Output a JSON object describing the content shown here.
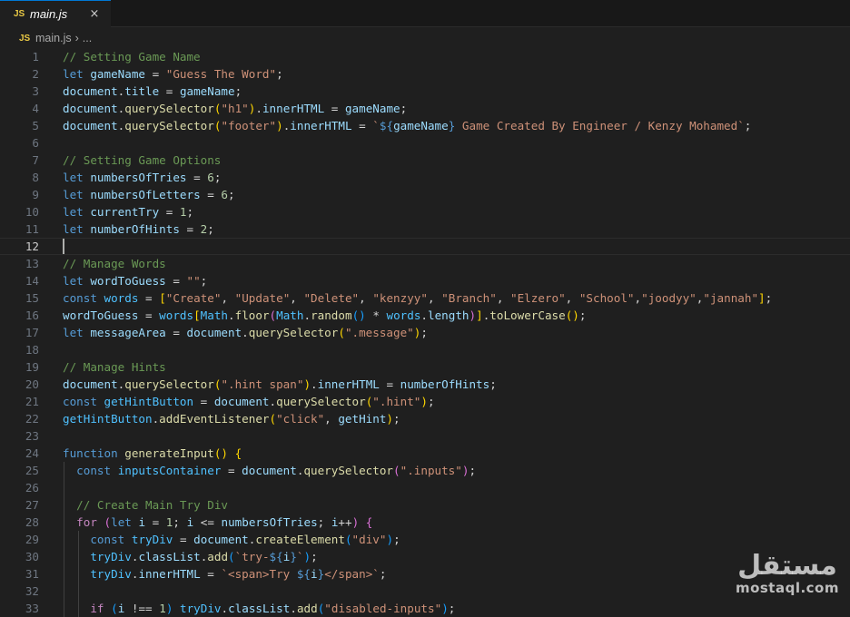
{
  "tab": {
    "icon_text": "JS",
    "file_name": "main.js",
    "close_glyph": "×"
  },
  "breadcrumb": {
    "icon_text": "JS",
    "file": "main.js",
    "separator": "›",
    "more": "..."
  },
  "editor": {
    "current_line": 12,
    "lines": [
      {
        "n": "1",
        "tokens": [
          [
            "cm",
            "// Setting Game Name"
          ]
        ]
      },
      {
        "n": "2",
        "tokens": [
          [
            "kw",
            "let"
          ],
          [
            "op",
            " "
          ],
          [
            "var",
            "gameName"
          ],
          [
            "op",
            " = "
          ],
          [
            "str",
            "\"Guess The Word\""
          ],
          [
            "op",
            ";"
          ]
        ]
      },
      {
        "n": "3",
        "tokens": [
          [
            "var",
            "document"
          ],
          [
            "op",
            "."
          ],
          [
            "var",
            "title"
          ],
          [
            "op",
            " = "
          ],
          [
            "var",
            "gameName"
          ],
          [
            "op",
            ";"
          ]
        ]
      },
      {
        "n": "4",
        "tokens": [
          [
            "var",
            "document"
          ],
          [
            "op",
            "."
          ],
          [
            "fn",
            "querySelector"
          ],
          [
            "b1",
            "("
          ],
          [
            "str",
            "\"h1\""
          ],
          [
            "b1",
            ")"
          ],
          [
            "op",
            "."
          ],
          [
            "var",
            "innerHTML"
          ],
          [
            "op",
            " = "
          ],
          [
            "var",
            "gameName"
          ],
          [
            "op",
            ";"
          ]
        ]
      },
      {
        "n": "5",
        "tokens": [
          [
            "var",
            "document"
          ],
          [
            "op",
            "."
          ],
          [
            "fn",
            "querySelector"
          ],
          [
            "b1",
            "("
          ],
          [
            "str",
            "\"footer\""
          ],
          [
            "b1",
            ")"
          ],
          [
            "op",
            "."
          ],
          [
            "var",
            "innerHTML"
          ],
          [
            "op",
            " = "
          ],
          [
            "str",
            "`"
          ],
          [
            "kw",
            "${"
          ],
          [
            "var",
            "gameName"
          ],
          [
            "kw",
            "}"
          ],
          [
            "str",
            " Game Created By Engineer / Kenzy Mohamed`"
          ],
          [
            "op",
            ";"
          ]
        ]
      },
      {
        "n": "6",
        "tokens": []
      },
      {
        "n": "7",
        "tokens": [
          [
            "cm",
            "// Setting Game Options"
          ]
        ]
      },
      {
        "n": "8",
        "tokens": [
          [
            "kw",
            "let"
          ],
          [
            "op",
            " "
          ],
          [
            "var",
            "numbersOfTries"
          ],
          [
            "op",
            " = "
          ],
          [
            "num",
            "6"
          ],
          [
            "op",
            ";"
          ]
        ]
      },
      {
        "n": "9",
        "tokens": [
          [
            "kw",
            "let"
          ],
          [
            "op",
            " "
          ],
          [
            "var",
            "numbersOfLetters"
          ],
          [
            "op",
            " = "
          ],
          [
            "num",
            "6"
          ],
          [
            "op",
            ";"
          ]
        ]
      },
      {
        "n": "10",
        "tokens": [
          [
            "kw",
            "let"
          ],
          [
            "op",
            " "
          ],
          [
            "var",
            "currentTry"
          ],
          [
            "op",
            " = "
          ],
          [
            "num",
            "1"
          ],
          [
            "op",
            ";"
          ]
        ]
      },
      {
        "n": "11",
        "tokens": [
          [
            "kw",
            "let"
          ],
          [
            "op",
            " "
          ],
          [
            "var",
            "numberOfHints"
          ],
          [
            "op",
            " = "
          ],
          [
            "num",
            "2"
          ],
          [
            "op",
            ";"
          ]
        ]
      },
      {
        "n": "12",
        "tokens": []
      },
      {
        "n": "13",
        "tokens": [
          [
            "cm",
            "// Manage Words"
          ]
        ]
      },
      {
        "n": "14",
        "tokens": [
          [
            "kw",
            "let"
          ],
          [
            "op",
            " "
          ],
          [
            "var",
            "wordToGuess"
          ],
          [
            "op",
            " = "
          ],
          [
            "str",
            "\"\""
          ],
          [
            "op",
            ";"
          ]
        ]
      },
      {
        "n": "15",
        "tokens": [
          [
            "kw",
            "const"
          ],
          [
            "op",
            " "
          ],
          [
            "cvar",
            "words"
          ],
          [
            "op",
            " = "
          ],
          [
            "b1",
            "["
          ],
          [
            "str",
            "\"Create\""
          ],
          [
            "op",
            ", "
          ],
          [
            "str",
            "\"Update\""
          ],
          [
            "op",
            ", "
          ],
          [
            "str",
            "\"Delete\""
          ],
          [
            "op",
            ", "
          ],
          [
            "str",
            "\"kenzyy\""
          ],
          [
            "op",
            ", "
          ],
          [
            "str",
            "\"Branch\""
          ],
          [
            "op",
            ", "
          ],
          [
            "str",
            "\"Elzero\""
          ],
          [
            "op",
            ", "
          ],
          [
            "str",
            "\"School\""
          ],
          [
            "op",
            ","
          ],
          [
            "str",
            "\"joodyy\""
          ],
          [
            "op",
            ","
          ],
          [
            "str",
            "\"jannah\""
          ],
          [
            "b1",
            "]"
          ],
          [
            "op",
            ";"
          ]
        ]
      },
      {
        "n": "16",
        "tokens": [
          [
            "var",
            "wordToGuess"
          ],
          [
            "op",
            " = "
          ],
          [
            "cvar",
            "words"
          ],
          [
            "b1",
            "["
          ],
          [
            "cvar",
            "Math"
          ],
          [
            "op",
            "."
          ],
          [
            "fn",
            "floor"
          ],
          [
            "b2",
            "("
          ],
          [
            "cvar",
            "Math"
          ],
          [
            "op",
            "."
          ],
          [
            "fn",
            "random"
          ],
          [
            "b3",
            "()"
          ],
          [
            "op",
            " * "
          ],
          [
            "cvar",
            "words"
          ],
          [
            "op",
            "."
          ],
          [
            "var",
            "length"
          ],
          [
            "b2",
            ")"
          ],
          [
            "b1",
            "]"
          ],
          [
            "op",
            "."
          ],
          [
            "fn",
            "toLowerCase"
          ],
          [
            "b1",
            "()"
          ],
          [
            "op",
            ";"
          ]
        ]
      },
      {
        "n": "17",
        "tokens": [
          [
            "kw",
            "let"
          ],
          [
            "op",
            " "
          ],
          [
            "var",
            "messageArea"
          ],
          [
            "op",
            " = "
          ],
          [
            "var",
            "document"
          ],
          [
            "op",
            "."
          ],
          [
            "fn",
            "querySelector"
          ],
          [
            "b1",
            "("
          ],
          [
            "str",
            "\".message\""
          ],
          [
            "b1",
            ")"
          ],
          [
            "op",
            ";"
          ]
        ]
      },
      {
        "n": "18",
        "tokens": []
      },
      {
        "n": "19",
        "tokens": [
          [
            "cm",
            "// Manage Hints"
          ]
        ]
      },
      {
        "n": "20",
        "tokens": [
          [
            "var",
            "document"
          ],
          [
            "op",
            "."
          ],
          [
            "fn",
            "querySelector"
          ],
          [
            "b1",
            "("
          ],
          [
            "str",
            "\".hint span\""
          ],
          [
            "b1",
            ")"
          ],
          [
            "op",
            "."
          ],
          [
            "var",
            "innerHTML"
          ],
          [
            "op",
            " = "
          ],
          [
            "var",
            "numberOfHints"
          ],
          [
            "op",
            ";"
          ]
        ]
      },
      {
        "n": "21",
        "tokens": [
          [
            "kw",
            "const"
          ],
          [
            "op",
            " "
          ],
          [
            "cvar",
            "getHintButton"
          ],
          [
            "op",
            " = "
          ],
          [
            "var",
            "document"
          ],
          [
            "op",
            "."
          ],
          [
            "fn",
            "querySelector"
          ],
          [
            "b1",
            "("
          ],
          [
            "str",
            "\".hint\""
          ],
          [
            "b1",
            ")"
          ],
          [
            "op",
            ";"
          ]
        ]
      },
      {
        "n": "22",
        "tokens": [
          [
            "cvar",
            "getHintButton"
          ],
          [
            "op",
            "."
          ],
          [
            "fn",
            "addEventListener"
          ],
          [
            "b1",
            "("
          ],
          [
            "str",
            "\"click\""
          ],
          [
            "op",
            ", "
          ],
          [
            "var",
            "getHint"
          ],
          [
            "b1",
            ")"
          ],
          [
            "op",
            ";"
          ]
        ]
      },
      {
        "n": "23",
        "tokens": []
      },
      {
        "n": "24",
        "tokens": [
          [
            "kw",
            "function"
          ],
          [
            "op",
            " "
          ],
          [
            "fn",
            "generateInput"
          ],
          [
            "b1",
            "()"
          ],
          [
            "op",
            " "
          ],
          [
            "b1",
            "{"
          ]
        ]
      },
      {
        "n": "25",
        "tokens": [
          [
            "op",
            "  "
          ],
          [
            "kw",
            "const"
          ],
          [
            "op",
            " "
          ],
          [
            "cvar",
            "inputsContainer"
          ],
          [
            "op",
            " = "
          ],
          [
            "var",
            "document"
          ],
          [
            "op",
            "."
          ],
          [
            "fn",
            "querySelector"
          ],
          [
            "b2",
            "("
          ],
          [
            "str",
            "\".inputs\""
          ],
          [
            "b2",
            ")"
          ],
          [
            "op",
            ";"
          ]
        ]
      },
      {
        "n": "26",
        "tokens": []
      },
      {
        "n": "27",
        "tokens": [
          [
            "op",
            "  "
          ],
          [
            "cm",
            "// Create Main Try Div"
          ]
        ]
      },
      {
        "n": "28",
        "tokens": [
          [
            "op",
            "  "
          ],
          [
            "cf",
            "for"
          ],
          [
            "op",
            " "
          ],
          [
            "b2",
            "("
          ],
          [
            "kw",
            "let"
          ],
          [
            "op",
            " "
          ],
          [
            "var",
            "i"
          ],
          [
            "op",
            " = "
          ],
          [
            "num",
            "1"
          ],
          [
            "op",
            "; "
          ],
          [
            "var",
            "i"
          ],
          [
            "op",
            " <= "
          ],
          [
            "var",
            "numbersOfTries"
          ],
          [
            "op",
            "; "
          ],
          [
            "var",
            "i"
          ],
          [
            "op",
            "++"
          ],
          [
            "b2",
            ")"
          ],
          [
            "op",
            " "
          ],
          [
            "b2",
            "{"
          ]
        ]
      },
      {
        "n": "29",
        "tokens": [
          [
            "op",
            "    "
          ],
          [
            "kw",
            "const"
          ],
          [
            "op",
            " "
          ],
          [
            "cvar",
            "tryDiv"
          ],
          [
            "op",
            " = "
          ],
          [
            "var",
            "document"
          ],
          [
            "op",
            "."
          ],
          [
            "fn",
            "createElement"
          ],
          [
            "b3",
            "("
          ],
          [
            "str",
            "\"div\""
          ],
          [
            "b3",
            ")"
          ],
          [
            "op",
            ";"
          ]
        ]
      },
      {
        "n": "30",
        "tokens": [
          [
            "op",
            "    "
          ],
          [
            "cvar",
            "tryDiv"
          ],
          [
            "op",
            "."
          ],
          [
            "var",
            "classList"
          ],
          [
            "op",
            "."
          ],
          [
            "fn",
            "add"
          ],
          [
            "b3",
            "("
          ],
          [
            "str",
            "`try-"
          ],
          [
            "kw",
            "${"
          ],
          [
            "var",
            "i"
          ],
          [
            "kw",
            "}"
          ],
          [
            "str",
            "`"
          ],
          [
            "b3",
            ")"
          ],
          [
            "op",
            ";"
          ]
        ]
      },
      {
        "n": "31",
        "tokens": [
          [
            "op",
            "    "
          ],
          [
            "cvar",
            "tryDiv"
          ],
          [
            "op",
            "."
          ],
          [
            "var",
            "innerHTML"
          ],
          [
            "op",
            " = "
          ],
          [
            "str",
            "`<span>Try "
          ],
          [
            "kw",
            "${"
          ],
          [
            "var",
            "i"
          ],
          [
            "kw",
            "}"
          ],
          [
            "str",
            "</span>`"
          ],
          [
            "op",
            ";"
          ]
        ]
      },
      {
        "n": "32",
        "tokens": []
      },
      {
        "n": "33",
        "tokens": [
          [
            "op",
            "    "
          ],
          [
            "cf",
            "if"
          ],
          [
            "op",
            " "
          ],
          [
            "b3",
            "("
          ],
          [
            "var",
            "i"
          ],
          [
            "op",
            " !== "
          ],
          [
            "num",
            "1"
          ],
          [
            "b3",
            ")"
          ],
          [
            "op",
            " "
          ],
          [
            "cvar",
            "tryDiv"
          ],
          [
            "op",
            "."
          ],
          [
            "var",
            "classList"
          ],
          [
            "op",
            "."
          ],
          [
            "fn",
            "add"
          ],
          [
            "b3",
            "("
          ],
          [
            "str",
            "\"disabled-inputs\""
          ],
          [
            "b3",
            ")"
          ],
          [
            "op",
            ";"
          ]
        ]
      }
    ]
  },
  "watermark": {
    "arabic": "مستقل",
    "latin": "mostaql.com"
  },
  "colors": {
    "background": "#1f1f1f",
    "comment": "#6a9955",
    "keyword": "#569cd6",
    "control": "#c586c0",
    "variable": "#9cdcfe",
    "constant": "#4fc1ff",
    "function": "#dcdcaa",
    "string": "#ce9178",
    "number": "#b5cea8",
    "accent": "#0078d4"
  }
}
